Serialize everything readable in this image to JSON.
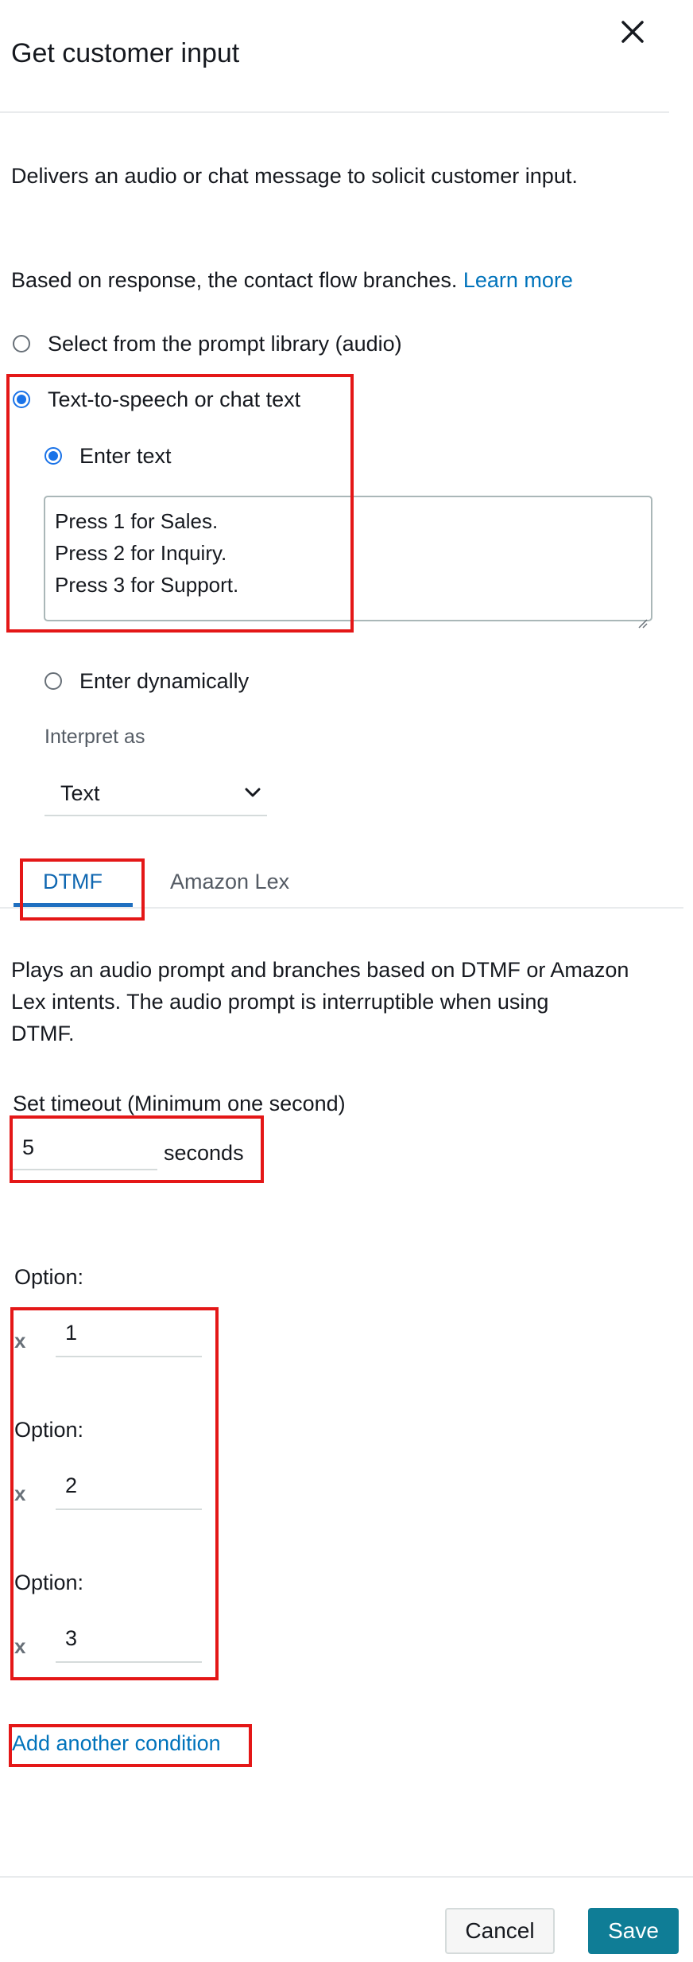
{
  "panel": {
    "title": "Get customer input",
    "close_icon": "close-icon"
  },
  "description": "Delivers an audio or chat message to solicit customer input.",
  "branch_text": "Based on response, the contact flow branches.",
  "learn_more": "Learn more",
  "prompt_options": {
    "library": "Select from the prompt library (audio)",
    "tts": "Text-to-speech or chat text",
    "enter_text": "Enter text",
    "enter_dynamically": "Enter dynamically",
    "selected": "tts"
  },
  "prompt_text": {
    "lines": [
      "Press 1 for Sales.",
      "Press 2 for Inquiry.",
      "Press 3 for Support."
    ]
  },
  "interpret": {
    "label": "Interpret as",
    "value": "Text"
  },
  "tabs": {
    "dtmf": "DTMF",
    "lex": "Amazon Lex",
    "active": "dtmf"
  },
  "tab_description": {
    "lines": [
      "Plays an audio prompt and branches based on DTMF or Amazon",
      "Lex intents. The audio prompt is interruptible when using",
      "DTMF."
    ]
  },
  "timeout": {
    "label": "Set timeout (Minimum one second)",
    "value": "5",
    "unit": "seconds"
  },
  "options": [
    {
      "label": "Option:",
      "remove": "x",
      "value": "1"
    },
    {
      "label": "Option:",
      "remove": "x",
      "value": "2"
    },
    {
      "label": "Option:",
      "remove": "x",
      "value": "3"
    }
  ],
  "add_condition": "Add another condition",
  "footer": {
    "cancel": "Cancel",
    "save": "Save"
  },
  "colors": {
    "accent_blue": "#1a73e8",
    "link": "#0073bb",
    "save_button": "#0f7d96",
    "highlight_box": "#e41717"
  }
}
